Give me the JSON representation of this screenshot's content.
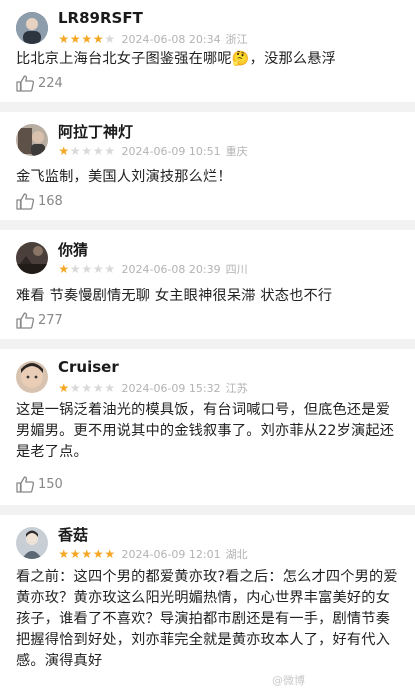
{
  "reviews": [
    {
      "user": "LR89RSFT",
      "stars": 4,
      "date": "2024-06-08 20:34",
      "location": "浙江",
      "content": "比北京上海台北女子图鉴强在哪呢🤔，没那么悬浮",
      "likes": "224",
      "avatar_color": "#6d7f8e"
    },
    {
      "user": "阿拉丁神灯",
      "stars": 1,
      "date": "2024-06-09 10:51",
      "location": "重庆",
      "content": "金飞监制，美国人刘演技那么烂！",
      "likes": "168",
      "avatar_color": "#7a6a5c"
    },
    {
      "user": "你猜",
      "stars": 1,
      "date": "2024-06-08 20:39",
      "location": "四川",
      "content": "难看 节奏慢剧情无聊 女主眼神很呆滞 状态也不行",
      "likes": "277",
      "avatar_color": "#3b3430"
    },
    {
      "user": "Cruiser",
      "stars": 1,
      "date": "2024-06-09 15:32",
      "location": "江苏",
      "content": "这是一锅泛着油光的模具饭，有台词喊口号，但底色还是爱男媚男。更不用说其中的金钱叙事了。刘亦菲从22岁演起还是老了点。",
      "likes": "150",
      "avatar_color": "#c9a58c"
    },
    {
      "user": "香菇",
      "stars": 5,
      "date": "2024-06-09 12:01",
      "location": "湖北",
      "content": "看之前：这四个男的都爱黄亦玫?看之后：怎么才四个男的爱黄亦玫？黄亦玫这么阳光明媚热情，内心世界丰富美好的女孩子，谁看了不喜欢？导演拍都市剧还是有一手，剧情节奏把握得恰到好处，刘亦菲完全就是黄亦玫本人了，好有代入感。演得真好",
      "likes": "",
      "avatar_color": "#9aa7b4"
    }
  ],
  "watermark": "@微博"
}
